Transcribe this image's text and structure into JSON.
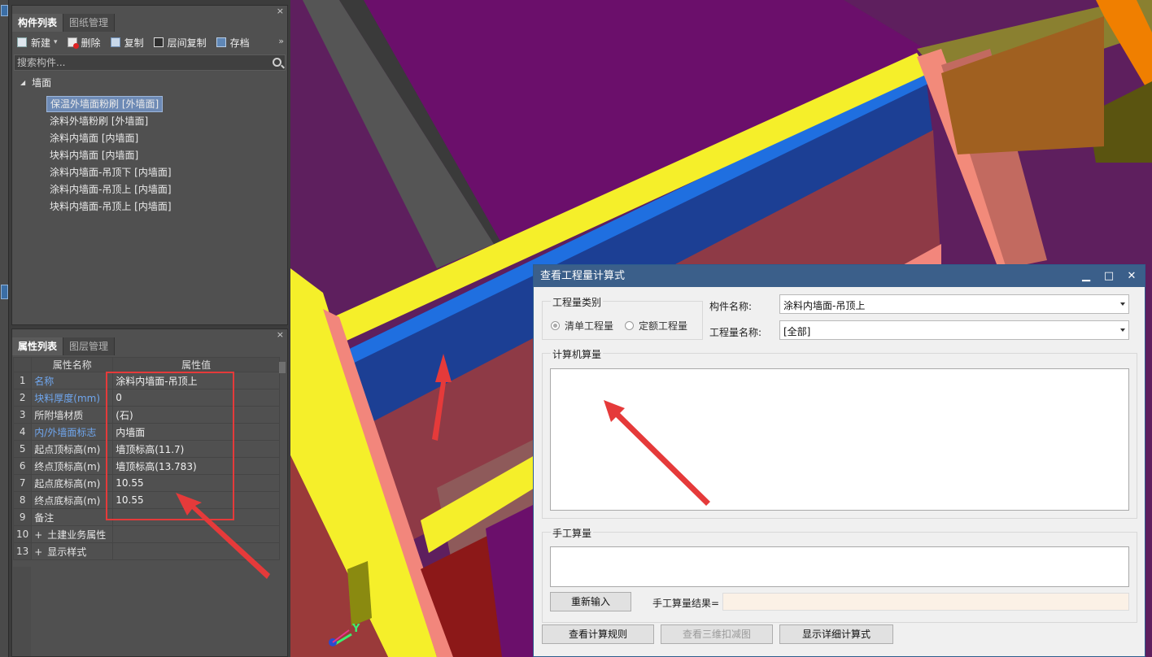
{
  "component_panel": {
    "tabs": [
      "构件列表",
      "图纸管理"
    ],
    "toolbar": {
      "new_label": "新建",
      "delete_label": "删除",
      "copy_label": "复制",
      "floor_copy_label": "层间复制",
      "archive_label": "存档",
      "more_glyph": "»"
    },
    "search_placeholder": "搜索构件...",
    "tree": {
      "root_label": "墙面",
      "items": [
        "保温外墙面粉刷 [外墙面]",
        "涂料外墙粉刷 [外墙面]",
        "涂料内墙面 [内墙面]",
        "块料内墙面 [内墙面]",
        "涂料内墙面-吊顶下 [内墙面]",
        "涂料内墙面-吊顶上 [内墙面]",
        "块料内墙面-吊顶上 [内墙面]"
      ],
      "selected_index": 0
    },
    "close_glyph": "×"
  },
  "property_panel": {
    "tabs": [
      "属性列表",
      "图层管理"
    ],
    "headers": [
      "属性名称",
      "属性值"
    ],
    "rows": [
      {
        "idx": "1",
        "name": "名称",
        "value": "涂料内墙面-吊顶上"
      },
      {
        "idx": "2",
        "name": "块料厚度(mm)",
        "value": "0"
      },
      {
        "idx": "3",
        "name": "所附墙材质",
        "value": "(石)"
      },
      {
        "idx": "4",
        "name": "内/外墙面标志",
        "value": "内墙面"
      },
      {
        "idx": "5",
        "name": "起点顶标高(m)",
        "value": "墙顶标高(11.7)"
      },
      {
        "idx": "6",
        "name": "终点顶标高(m)",
        "value": "墙顶标高(13.783)"
      },
      {
        "idx": "7",
        "name": "起点底标高(m)",
        "value": "10.55"
      },
      {
        "idx": "8",
        "name": "终点底标高(m)",
        "value": "10.55"
      },
      {
        "idx": "9",
        "name": "备注",
        "value": ""
      },
      {
        "idx": "10",
        "name": "土建业务属性",
        "value": ""
      },
      {
        "idx": "13",
        "name": "显示样式",
        "value": ""
      }
    ],
    "expand_glyph": "+",
    "close_glyph": "×"
  },
  "viewport": {
    "axis_label": "Y"
  },
  "dialog": {
    "title": "查看工程量计算式",
    "min_glyph": "▁",
    "max_glyph": "□",
    "close_glyph": "✕",
    "quantity_type_title": "工程量类别",
    "radio_list": "清单工程量",
    "radio_quota": "定额工程量",
    "component_name_label": "构件名称:",
    "component_name_value": "涂料内墙面-吊顶上",
    "quantity_name_label": "工程量名称:",
    "quantity_name_value": "[全部]",
    "computer_calc_title": "计算机算量",
    "manual_calc_title": "手工算量",
    "reenter_button": "重新输入",
    "manual_result_label": "手工算量结果=",
    "view_rules_button": "查看计算规则",
    "view_3d_button": "查看三维扣减图",
    "show_detail_button": "显示详细计算式"
  }
}
